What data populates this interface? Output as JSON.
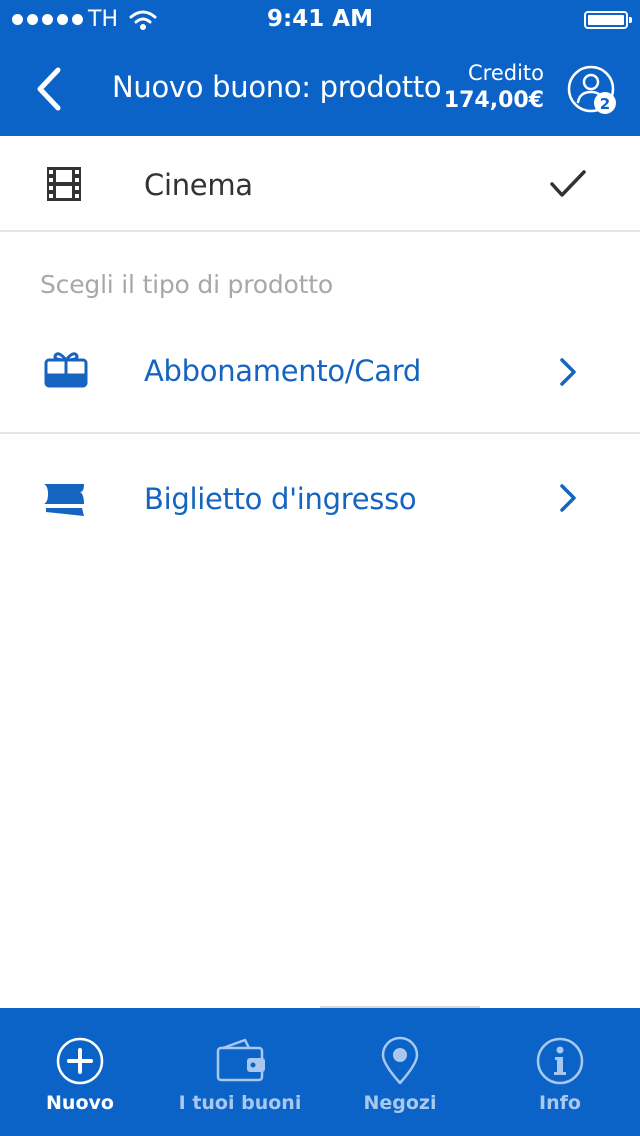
{
  "status_bar": {
    "carrier": "TH",
    "time": "9:41 AM"
  },
  "nav": {
    "title": "Nuovo buono: prodotto",
    "credit_label": "Credito",
    "credit_value": "174,00€",
    "profile_badge": "2"
  },
  "selected_category": {
    "label": "Cinema",
    "icon": "film-icon",
    "selected": true
  },
  "section": {
    "header": "Scegli il tipo di prodotto"
  },
  "products": [
    {
      "label": "Abbonamento/Card",
      "icon": "gift-card-icon"
    },
    {
      "label": "Biglietto d'ingresso",
      "icon": "ticket-icon"
    }
  ],
  "tabs": [
    {
      "label": "Nuovo",
      "icon": "plus-circle-icon",
      "active": true
    },
    {
      "label": "I tuoi buoni",
      "icon": "wallet-icon",
      "active": false
    },
    {
      "label": "Negozi",
      "icon": "map-pin-icon",
      "active": false
    },
    {
      "label": "Info",
      "icon": "info-icon",
      "active": false
    }
  ],
  "colors": {
    "brand_blue": "#0b63c8",
    "link_blue": "#1565c0",
    "text_dark": "#333333",
    "section_gray": "#a8a8a8",
    "inactive_tab": "#a9c8ef"
  }
}
